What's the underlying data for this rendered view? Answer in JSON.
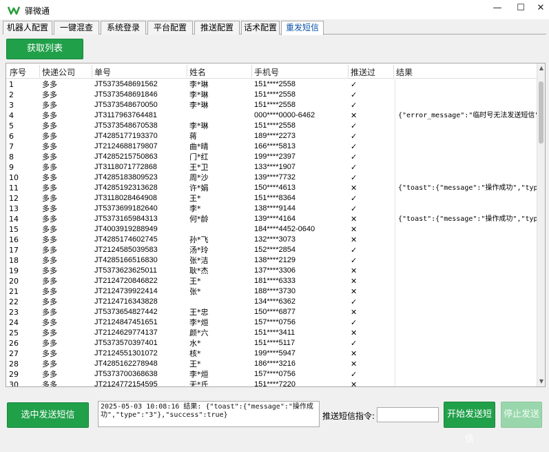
{
  "app": {
    "title": "驿微通",
    "logo": "W"
  },
  "window_controls": {
    "minimize": "—",
    "maximize": "☐",
    "close": "✕"
  },
  "tabs": [
    {
      "label": "机器人配置"
    },
    {
      "label": "一键混查"
    },
    {
      "label": "系统登录"
    },
    {
      "label": "平台配置"
    },
    {
      "label": "推送配置"
    },
    {
      "label": "话术配置"
    },
    {
      "label": "重发短信",
      "active": true
    }
  ],
  "actions": {
    "fetch_list": "获取列表",
    "send_selected": "选中发送短信",
    "start_send": "开始发送短信",
    "stop_send": "停止发送"
  },
  "command": {
    "label": "推送短信指令:",
    "value": ""
  },
  "log": {
    "text": "2025-05-03 10:08:16 结果: {\"toast\":{\"message\":\"操作成功\",\"type\":\"3\"},\"success\":true}"
  },
  "table": {
    "columns": [
      "序号",
      "快递公司",
      "单号",
      "姓名",
      "手机号",
      "推送过",
      "结果"
    ],
    "rows": [
      {
        "seq": "1",
        "company": "多多",
        "tracking": "JT5373548691562",
        "name": "李*琳",
        "phone": "151****2558",
        "pushed": "✓",
        "result": ""
      },
      {
        "seq": "2",
        "company": "多多",
        "tracking": "JT5373548691846",
        "name": "李*琳",
        "phone": "151****2558",
        "pushed": "✓",
        "result": ""
      },
      {
        "seq": "3",
        "company": "多多",
        "tracking": "JT5373548670050",
        "name": "李*琳",
        "phone": "151****2558",
        "pushed": "✓",
        "result": ""
      },
      {
        "seq": "4",
        "company": "多多",
        "tracking": "JT3117963764481",
        "name": "",
        "phone": "000****0000-6462",
        "pushed": "✕",
        "result": "{\"error_message\":\"临时号无法发送短信\","
      },
      {
        "seq": "5",
        "company": "多多",
        "tracking": "JT5373548670538",
        "name": "李*琳",
        "phone": "151****2558",
        "pushed": "✓",
        "result": ""
      },
      {
        "seq": "6",
        "company": "多多",
        "tracking": "JT4285177193370",
        "name": "蒋",
        "phone": "189****2273",
        "pushed": "✓",
        "result": ""
      },
      {
        "seq": "7",
        "company": "多多",
        "tracking": "JT2124688179807",
        "name": "曲*晴",
        "phone": "166****5813",
        "pushed": "✓",
        "result": ""
      },
      {
        "seq": "8",
        "company": "多多",
        "tracking": "JT4285215750863",
        "name": "门*红",
        "phone": "199****2397",
        "pushed": "✓",
        "result": ""
      },
      {
        "seq": "9",
        "company": "多多",
        "tracking": "JT3118071772868",
        "name": "王*卫",
        "phone": "133****1907",
        "pushed": "✓",
        "result": ""
      },
      {
        "seq": "10",
        "company": "多多",
        "tracking": "JT4285183809523",
        "name": "周*沙",
        "phone": "139****7732",
        "pushed": "✓",
        "result": ""
      },
      {
        "seq": "11",
        "company": "多多",
        "tracking": "JT4285192313628",
        "name": "许*娟",
        "phone": "150****4613",
        "pushed": "✕",
        "result": "{\"toast\":{\"message\":\"操作成功\",\"type\":"
      },
      {
        "seq": "12",
        "company": "多多",
        "tracking": "JT3118028464908",
        "name": "王*",
        "phone": "151****8364",
        "pushed": "✓",
        "result": ""
      },
      {
        "seq": "13",
        "company": "多多",
        "tracking": "JT5373699182640",
        "name": "李*",
        "phone": "138****9144",
        "pushed": "✓",
        "result": ""
      },
      {
        "seq": "14",
        "company": "多多",
        "tracking": "JT5373165984313",
        "name": "何*龄",
        "phone": "139****4164",
        "pushed": "✕",
        "result": "{\"toast\":{\"message\":\"操作成功\",\"type\":"
      },
      {
        "seq": "15",
        "company": "多多",
        "tracking": "JT4003919288949",
        "name": "",
        "phone": "184****4452-0640",
        "pushed": "✕",
        "result": ""
      },
      {
        "seq": "16",
        "company": "多多",
        "tracking": "JT4285174602745",
        "name": "孙*飞",
        "phone": "132****3073",
        "pushed": "✕",
        "result": ""
      },
      {
        "seq": "17",
        "company": "多多",
        "tracking": "JT2124585039583",
        "name": "汤*玲",
        "phone": "152****2854",
        "pushed": "✓",
        "result": ""
      },
      {
        "seq": "18",
        "company": "多多",
        "tracking": "JT4285166516830",
        "name": "张*洁",
        "phone": "138****2129",
        "pushed": "✓",
        "result": ""
      },
      {
        "seq": "19",
        "company": "多多",
        "tracking": "JT5373623625011",
        "name": "耿*杰",
        "phone": "137****3306",
        "pushed": "✕",
        "result": ""
      },
      {
        "seq": "20",
        "company": "多多",
        "tracking": "JT2124720846822",
        "name": "王*",
        "phone": "181****6333",
        "pushed": "✕",
        "result": ""
      },
      {
        "seq": "21",
        "company": "多多",
        "tracking": "JT2124739922414",
        "name": "张*",
        "phone": "188****3730",
        "pushed": "✕",
        "result": ""
      },
      {
        "seq": "22",
        "company": "多多",
        "tracking": "JT2124716343828",
        "name": "",
        "phone": "134****6362",
        "pushed": "✓",
        "result": ""
      },
      {
        "seq": "23",
        "company": "多多",
        "tracking": "JT5373654827442",
        "name": "王*忠",
        "phone": "150****6877",
        "pushed": "✕",
        "result": ""
      },
      {
        "seq": "24",
        "company": "多多",
        "tracking": "JT2124847451651",
        "name": "李*烜",
        "phone": "157****0756",
        "pushed": "✓",
        "result": ""
      },
      {
        "seq": "25",
        "company": "多多",
        "tracking": "JT2124629774137",
        "name": "颜*六",
        "phone": "151****3411",
        "pushed": "✕",
        "result": ""
      },
      {
        "seq": "26",
        "company": "多多",
        "tracking": "JT5373570397401",
        "name": "水*",
        "phone": "151****5117",
        "pushed": "✓",
        "result": ""
      },
      {
        "seq": "27",
        "company": "多多",
        "tracking": "JT2124551301072",
        "name": "核*",
        "phone": "199****5947",
        "pushed": "✕",
        "result": ""
      },
      {
        "seq": "28",
        "company": "多多",
        "tracking": "JT4285162278948",
        "name": "王*",
        "phone": "186****3216",
        "pushed": "✕",
        "result": ""
      },
      {
        "seq": "29",
        "company": "多多",
        "tracking": "JT5373700368638",
        "name": "李*烜",
        "phone": "157****0756",
        "pushed": "✓",
        "result": ""
      },
      {
        "seq": "30",
        "company": "多多",
        "tracking": "JT2124772154595",
        "name": "无*氏",
        "phone": "151****7220",
        "pushed": "✕",
        "result": ""
      }
    ]
  },
  "colors": {
    "accent_green": "#21a04a",
    "active_tab_text": "#0a53a8",
    "disabled_green": "#9ad6ac"
  }
}
